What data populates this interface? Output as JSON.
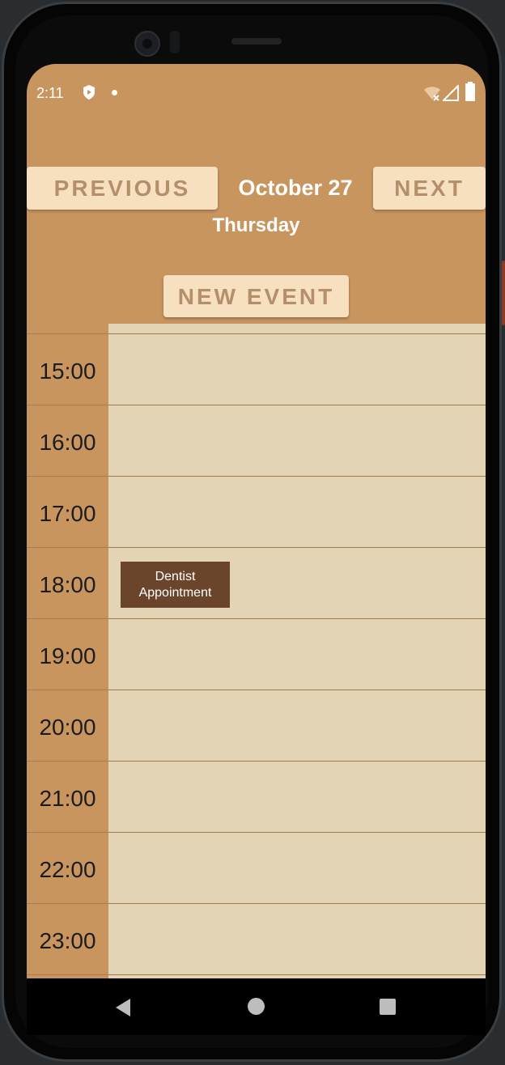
{
  "status_bar": {
    "time": "2:11"
  },
  "header": {
    "previous_label": "PREVIOUS",
    "next_label": "NEXT",
    "date": "October 27",
    "day": "Thursday"
  },
  "actions": {
    "new_event_label": "NEW EVENT"
  },
  "schedule": {
    "hours": [
      "15:00",
      "16:00",
      "17:00",
      "18:00",
      "19:00",
      "20:00",
      "21:00",
      "22:00",
      "23:00"
    ],
    "events": [
      {
        "title": "Dentist Appointment",
        "hour": "18:00"
      }
    ]
  },
  "colors": {
    "background": "#c8955f",
    "button": "#f6e0c0",
    "button_text": "#b58f6c",
    "event_area": "#e3d4b6",
    "event_block": "#6a452c"
  },
  "icons": {
    "status": [
      "shield-icon",
      "dot-icon",
      "wifi-icon",
      "signal-icon",
      "battery-icon"
    ],
    "nav": [
      "back-icon",
      "home-icon",
      "recents-icon"
    ]
  }
}
